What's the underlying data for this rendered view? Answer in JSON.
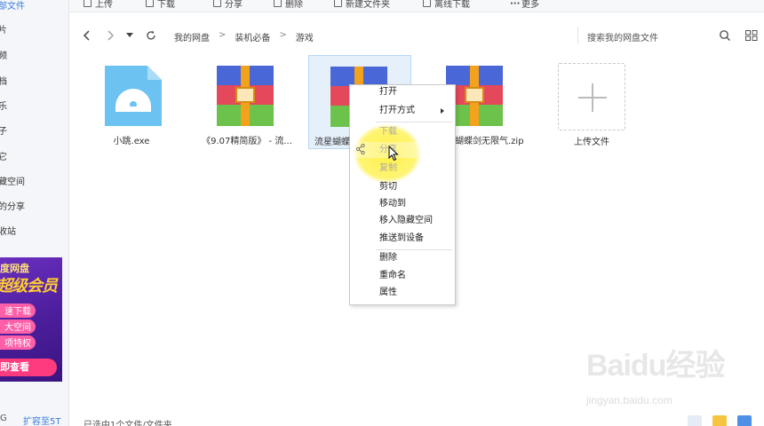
{
  "toolbar": {
    "items": [
      "上传",
      "下载",
      "分享",
      "删除",
      "新建文件夹",
      "离线下载",
      "更多"
    ]
  },
  "sidebar": {
    "items": [
      "部文件",
      "片",
      "频",
      "档",
      "乐",
      "子",
      "它",
      "藏空间",
      "的分享",
      "收站"
    ],
    "ad": {
      "brand": "度网盘",
      "headline": "超级会员",
      "lines": [
        "速下载",
        "大空间",
        "项特权"
      ],
      "cta": "即查看"
    },
    "storage": "G",
    "expand": "扩容至5T"
  },
  "nav": {
    "breadcrumb": [
      "我的网盘",
      "装机必备",
      "游戏"
    ],
    "search_placeholder": "搜索我的网盘文件"
  },
  "files": [
    {
      "name": "小跳.exe",
      "icon": "exe-disc-icon"
    },
    {
      "name": "《9.07精简版》 - 流...",
      "icon": "winrar-archive-icon"
    },
    {
      "name": "流星蝴蝶",
      "icon": "winrar-archive-icon",
      "selected": true
    },
    {
      "name": "蝴蝶剑无限气.zip",
      "icon": "winrar-archive-icon"
    }
  ],
  "upload_label": "上传文件",
  "context_menu": {
    "items": [
      {
        "label": "打开",
        "disabled": false
      },
      {
        "label": "打开方式",
        "disabled": false,
        "submenu": true
      },
      {
        "label": "下载",
        "disabled": true
      },
      {
        "label": "分享",
        "disabled": true
      },
      {
        "label": "复制",
        "disabled": true
      },
      {
        "label": "剪切",
        "disabled": false
      },
      {
        "label": "移动到",
        "disabled": false
      },
      {
        "label": "移入隐藏空间",
        "disabled": false
      },
      {
        "label": "推送到设备",
        "disabled": false
      },
      {
        "label": "删除",
        "disabled": false
      },
      {
        "label": "重命名",
        "disabled": false
      },
      {
        "label": "属性",
        "disabled": false
      }
    ]
  },
  "status": {
    "text": "已选中1个文件/文件夹"
  },
  "watermark": {
    "logo": "Baidu经验",
    "url": "jingyan.baidu.com"
  },
  "colors": {
    "accent": "#3b7ddd",
    "selected_bg": "#e5f0fb",
    "highlight": "#ffee28",
    "ad_bg": "#5a25ad",
    "ad_pink": "#ff3b7f"
  }
}
